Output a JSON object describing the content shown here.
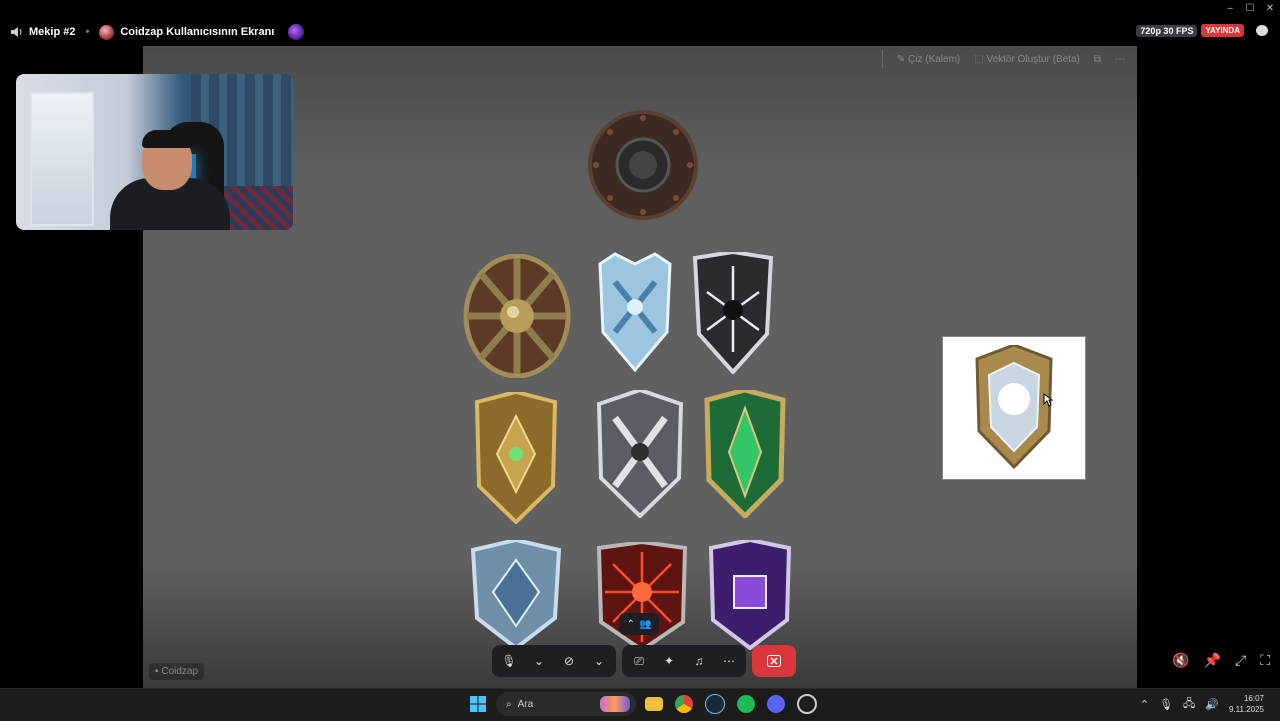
{
  "window": {
    "minimize": "–",
    "maximize": "☐",
    "close": "✕"
  },
  "topbar": {
    "channel": "Mekip #2",
    "stream_title": "Coidzap Kullanıcısının Ekranı",
    "quality": "720p 30 FPS",
    "live_badge": "YAYINDA"
  },
  "stage_toolbar": {
    "draw_label": "Çiz (Kalem)",
    "vector_label": "Vektör Oluştur (Beta)"
  },
  "stage": {
    "name_tag": "Coidzap"
  },
  "taskbar": {
    "search_placeholder": "Ara",
    "time": "16:07",
    "date": "9.11.2025"
  },
  "colors": {
    "end_call": "#da373c",
    "live": "#da373c",
    "taskbar": "#1c1c1c"
  }
}
